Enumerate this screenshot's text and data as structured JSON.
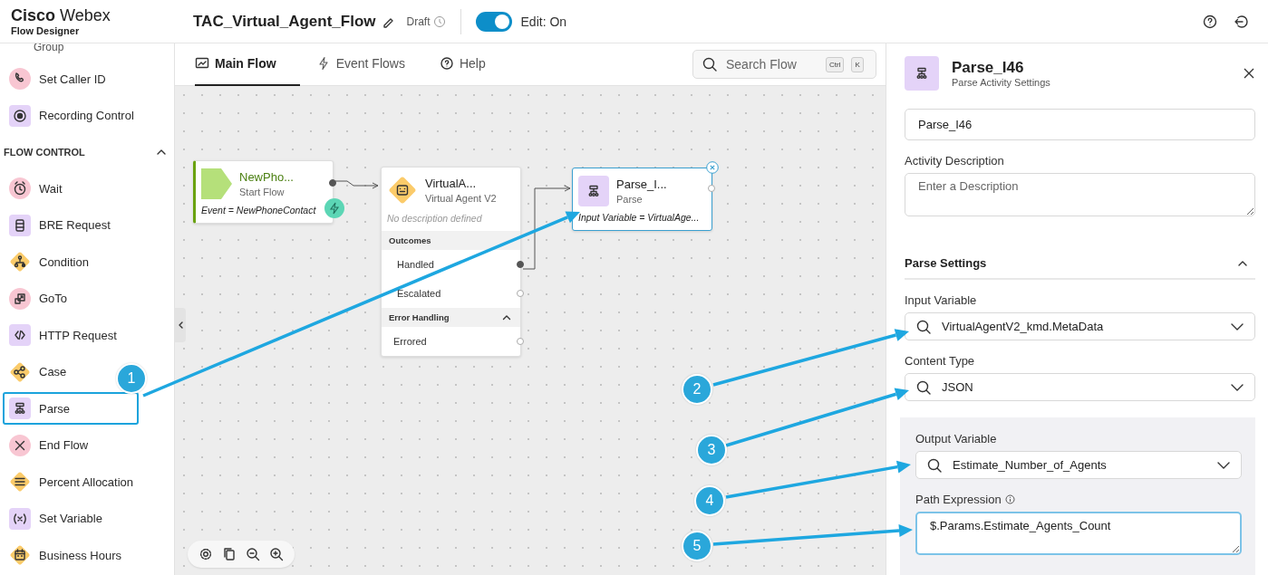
{
  "header": {
    "brand": "**Cisco** Webex",
    "product": "Flow Designer",
    "flow_title": "TAC_Virtual_Agent_Flow",
    "status": "Draft",
    "edit_toggle": {
      "label": "Edit: On",
      "on": true
    }
  },
  "sidebar": {
    "cut_item": "Group",
    "items": [
      {
        "label": "Set Caller ID",
        "kind": "circle",
        "color": "#f8c6d2",
        "highlighted": false
      },
      {
        "label": "Recording Control",
        "kind": "square",
        "color": "#e4d3f8",
        "highlighted": false
      }
    ],
    "sections": [
      {
        "title": "FLOW CONTROL",
        "expanded": true,
        "items": [
          {
            "label": "Wait",
            "kind": "circle",
            "color": "#f8c6d2",
            "highlighted": false
          },
          {
            "label": "BRE Request",
            "kind": "square",
            "color": "#e4d3f8",
            "highlighted": false
          },
          {
            "label": "Condition",
            "kind": "diamond",
            "color": "#fbcb6a",
            "highlighted": false
          },
          {
            "label": "GoTo",
            "kind": "circle",
            "color": "#f8c6d2",
            "highlighted": false
          },
          {
            "label": "HTTP Request",
            "kind": "square",
            "color": "#e4d3f8",
            "highlighted": false
          },
          {
            "label": "Case",
            "kind": "diamond",
            "color": "#fbcb6a",
            "highlighted": false
          },
          {
            "label": "Parse",
            "kind": "square",
            "color": "#e4d3f8",
            "highlighted": true
          },
          {
            "label": "End Flow",
            "kind": "circle",
            "color": "#f8c6d2",
            "highlighted": false
          },
          {
            "label": "Percent Allocation",
            "kind": "diamond",
            "color": "#fbcb6a",
            "highlighted": false
          },
          {
            "label": "Set Variable",
            "kind": "square",
            "color": "#e4d3f8",
            "highlighted": false
          },
          {
            "label": "Business Hours",
            "kind": "diamond",
            "color": "#fbcb6a",
            "highlighted": false
          }
        ]
      }
    ]
  },
  "tabs": [
    {
      "label": "Main Flow",
      "selected": true
    },
    {
      "label": "Event Flows",
      "selected": false
    },
    {
      "label": "Help",
      "selected": false
    }
  ],
  "search": {
    "placeholder": "Search Flow",
    "shortcut": [
      "Ctrl",
      "K"
    ]
  },
  "canvas": {
    "nodes": [
      {
        "kind": "start",
        "title": "NewPho...",
        "subtitle": "Start Flow",
        "detail": "Event = NewPhoneContact",
        "color": "#b5e07a",
        "selected": false
      },
      {
        "kind": "activity",
        "title": "VirtualA...",
        "subtitle": "Virtual Agent V2",
        "description": "No description defined",
        "color": "#fbcb6a",
        "selected": false,
        "sections": [
          {
            "title": "Outcomes",
            "collapsible": false,
            "outputs": [
              "Handled",
              "Escalated"
            ]
          },
          {
            "title": "Error Handling",
            "collapsible": true,
            "outputs": [
              "Errored"
            ]
          }
        ]
      },
      {
        "kind": "activity",
        "title": "Parse_I...",
        "subtitle": "Parse",
        "detail": "Input Variable = VirtualAge...",
        "color": "#e4d3f8",
        "selected": true
      }
    ]
  },
  "panel": {
    "title": "Parse_I46",
    "subtitle": "Parse Activity Settings",
    "name_value": "Parse_I46",
    "description": {
      "label": "Activity Description",
      "placeholder": "Enter a Description"
    },
    "section": {
      "title": "Parse Settings",
      "expanded": true
    },
    "fields": [
      {
        "kind": "select",
        "label": "Input Variable",
        "value": "VirtualAgentV2_kmd.MetaData",
        "info": false,
        "focused": false
      },
      {
        "kind": "select",
        "label": "Content Type",
        "value": "JSON",
        "info": false,
        "focused": false
      }
    ],
    "output_group": {
      "fields": [
        {
          "kind": "select",
          "label": "Output Variable",
          "value": "Estimate_Number_of_Agents",
          "info": false,
          "focused": false
        },
        {
          "kind": "textarea",
          "label": "Path Expression",
          "value": "$.Params.Estimate_Agents_Count",
          "info": true,
          "focused": true
        }
      ]
    }
  },
  "callouts": [
    {
      "label": "1"
    },
    {
      "label": "2"
    },
    {
      "label": "3"
    },
    {
      "label": "4"
    },
    {
      "label": "5"
    }
  ]
}
